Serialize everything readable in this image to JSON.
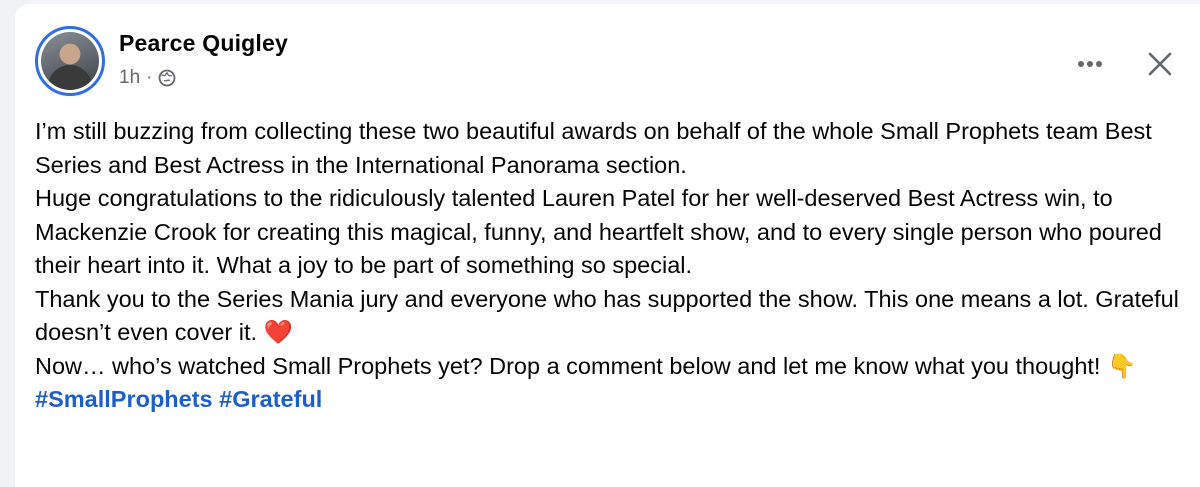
{
  "post": {
    "author": "Pearce Quigley",
    "time": "1h",
    "separator": "·",
    "privacy_icon": "globe-icon",
    "more_icon": "more-icon",
    "close_icon": "close-icon",
    "lines": [
      "I’m still buzzing from collecting these two beautiful awards on behalf of the whole Small Prophets team Best Series and Best Actress in the International Panorama section.",
      "Huge congratulations to the ridiculously talented Lauren Patel for her well-deserved Best Actress win, to Mackenzie Crook for creating this magical, funny, and heartfelt show, and to every single person who poured their heart into it. What a joy to be part of something so special.",
      "Thank you to the Series Mania jury and everyone who has supported the show. This one means a lot. Grateful doesn’t even cover it.",
      "Now… who’s watched Small Prophets yet? Drop a comment below and let me know what you thought!"
    ],
    "heart_emoji": "❤️",
    "pointing_emoji": "👇",
    "hashtags": [
      "#SmallProphets",
      "#Grateful"
    ]
  },
  "colors": {
    "accent_ring": "#2f6fe0",
    "hashtag": "#1d5fc9",
    "meta_gray": "#65676b"
  }
}
